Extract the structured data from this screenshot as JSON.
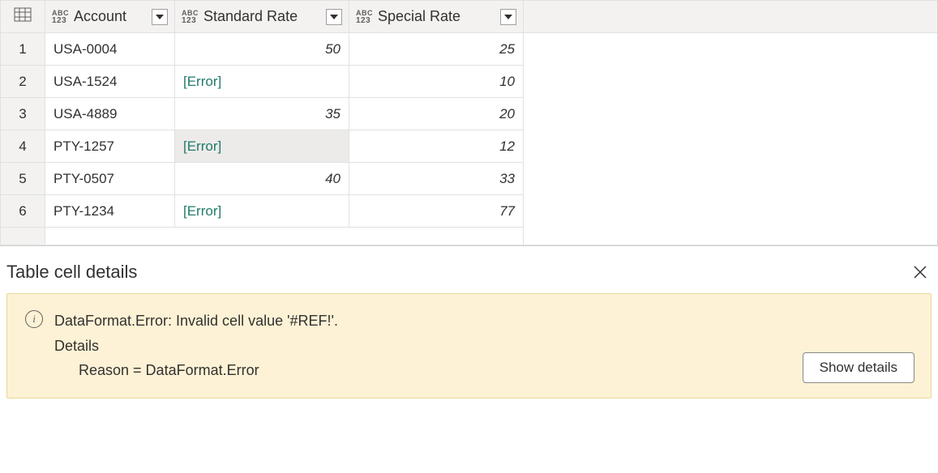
{
  "table": {
    "columns": [
      {
        "type_abc": "ABC",
        "type_num": "123",
        "title": "Account"
      },
      {
        "type_abc": "ABC",
        "type_num": "123",
        "title": "Standard Rate"
      },
      {
        "type_abc": "ABC",
        "type_num": "123",
        "title": "Special Rate"
      }
    ],
    "rows": [
      {
        "n": "1",
        "account": "USA-0004",
        "std": "50",
        "std_error": false,
        "spec": "25"
      },
      {
        "n": "2",
        "account": "USA-1524",
        "std": "[Error]",
        "std_error": true,
        "spec": "10"
      },
      {
        "n": "3",
        "account": "USA-4889",
        "std": "35",
        "std_error": false,
        "spec": "20"
      },
      {
        "n": "4",
        "account": "PTY-1257",
        "std": "[Error]",
        "std_error": true,
        "spec": "12",
        "selected": true
      },
      {
        "n": "5",
        "account": "PTY-0507",
        "std": "40",
        "std_error": false,
        "spec": "33"
      },
      {
        "n": "6",
        "account": "PTY-1234",
        "std": "[Error]",
        "std_error": true,
        "spec": "77"
      }
    ]
  },
  "details": {
    "title": "Table cell details",
    "error_line": "DataFormat.Error: Invalid cell value '#REF!'.",
    "details_label": "Details",
    "reason_line": "Reason = DataFormat.Error",
    "show_details_label": "Show details"
  }
}
